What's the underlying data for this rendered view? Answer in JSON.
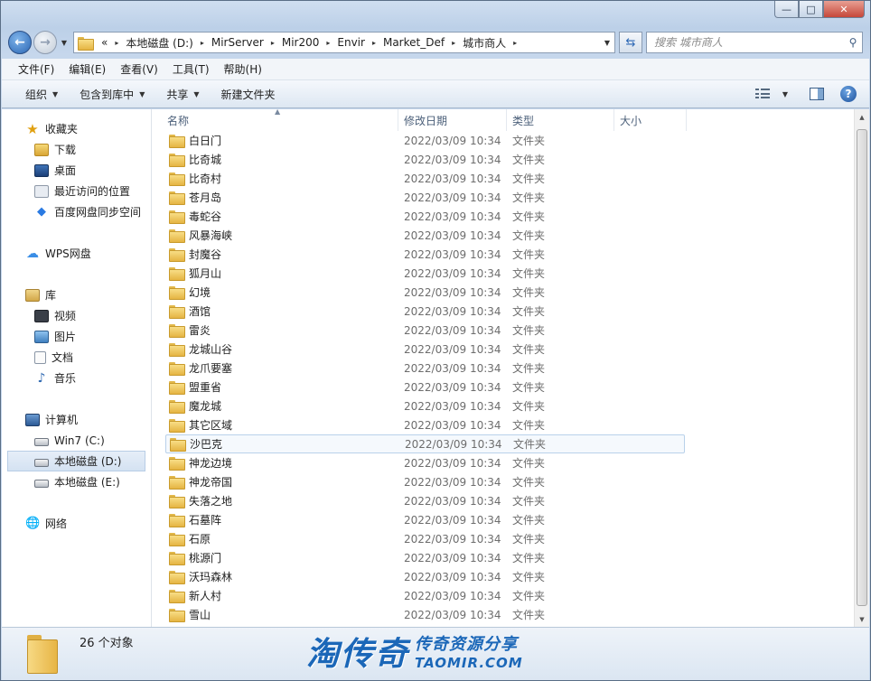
{
  "window": {
    "minimize_symbol": "—",
    "maximize_symbol": "□",
    "close_symbol": "✕"
  },
  "address": {
    "overflow": "«",
    "crumbs": [
      "本地磁盘 (D:)",
      "MirServer",
      "Mir200",
      "Envir",
      "Market_Def",
      "城市商人"
    ],
    "search_placeholder": "搜索 城市商人"
  },
  "menu": [
    "文件(F)",
    "编辑(E)",
    "查看(V)",
    "工具(T)",
    "帮助(H)"
  ],
  "toolbar": {
    "organize": "组织",
    "include_library": "包含到库中",
    "share": "共享",
    "new_folder": "新建文件夹",
    "help_symbol": "?"
  },
  "navpane": {
    "favorites": "收藏夹",
    "favorites_items": [
      "下载",
      "桌面",
      "最近访问的位置",
      "百度网盘同步空间"
    ],
    "wps": "WPS网盘",
    "library": "库",
    "library_items": [
      "视频",
      "图片",
      "文档",
      "音乐"
    ],
    "computer": "计算机",
    "computer_items": [
      "Win7 (C:)",
      "本地磁盘 (D:)",
      "本地磁盘 (E:)"
    ],
    "network": "网络"
  },
  "columns": {
    "name": "名称",
    "date": "修改日期",
    "type": "类型",
    "size": "大小"
  },
  "files": [
    {
      "name": "白日门",
      "date": "2022/03/09 10:34",
      "type": "文件夹"
    },
    {
      "name": "比奇城",
      "date": "2022/03/09 10:34",
      "type": "文件夹"
    },
    {
      "name": "比奇村",
      "date": "2022/03/09 10:34",
      "type": "文件夹"
    },
    {
      "name": "苍月岛",
      "date": "2022/03/09 10:34",
      "type": "文件夹"
    },
    {
      "name": "毒蛇谷",
      "date": "2022/03/09 10:34",
      "type": "文件夹"
    },
    {
      "name": "风暴海峡",
      "date": "2022/03/09 10:34",
      "type": "文件夹"
    },
    {
      "name": "封魔谷",
      "date": "2022/03/09 10:34",
      "type": "文件夹"
    },
    {
      "name": "狐月山",
      "date": "2022/03/09 10:34",
      "type": "文件夹"
    },
    {
      "name": "幻境",
      "date": "2022/03/09 10:34",
      "type": "文件夹"
    },
    {
      "name": "酒馆",
      "date": "2022/03/09 10:34",
      "type": "文件夹"
    },
    {
      "name": "雷炎",
      "date": "2022/03/09 10:34",
      "type": "文件夹"
    },
    {
      "name": "龙城山谷",
      "date": "2022/03/09 10:34",
      "type": "文件夹"
    },
    {
      "name": "龙爪要塞",
      "date": "2022/03/09 10:34",
      "type": "文件夹"
    },
    {
      "name": "盟重省",
      "date": "2022/03/09 10:34",
      "type": "文件夹"
    },
    {
      "name": "魔龙城",
      "date": "2022/03/09 10:34",
      "type": "文件夹"
    },
    {
      "name": "其它区域",
      "date": "2022/03/09 10:34",
      "type": "文件夹"
    },
    {
      "name": "沙巴克",
      "date": "2022/03/09 10:34",
      "type": "文件夹"
    },
    {
      "name": "神龙边境",
      "date": "2022/03/09 10:34",
      "type": "文件夹"
    },
    {
      "name": "神龙帝国",
      "date": "2022/03/09 10:34",
      "type": "文件夹"
    },
    {
      "name": "失落之地",
      "date": "2022/03/09 10:34",
      "type": "文件夹"
    },
    {
      "name": "石墓阵",
      "date": "2022/03/09 10:34",
      "type": "文件夹"
    },
    {
      "name": "石原",
      "date": "2022/03/09 10:34",
      "type": "文件夹"
    },
    {
      "name": "桃源门",
      "date": "2022/03/09 10:34",
      "type": "文件夹"
    },
    {
      "name": "沃玛森林",
      "date": "2022/03/09 10:34",
      "type": "文件夹"
    },
    {
      "name": "新人村",
      "date": "2022/03/09 10:34",
      "type": "文件夹"
    },
    {
      "name": "雪山",
      "date": "2022/03/09 10:34",
      "type": "文件夹"
    }
  ],
  "hovered_file": "沙巴克",
  "status": {
    "object_count": "26 个对象"
  },
  "watermark": {
    "brand": "淘传奇",
    "tagline": "传奇资源分享",
    "url": "TAOMIR.COM"
  }
}
